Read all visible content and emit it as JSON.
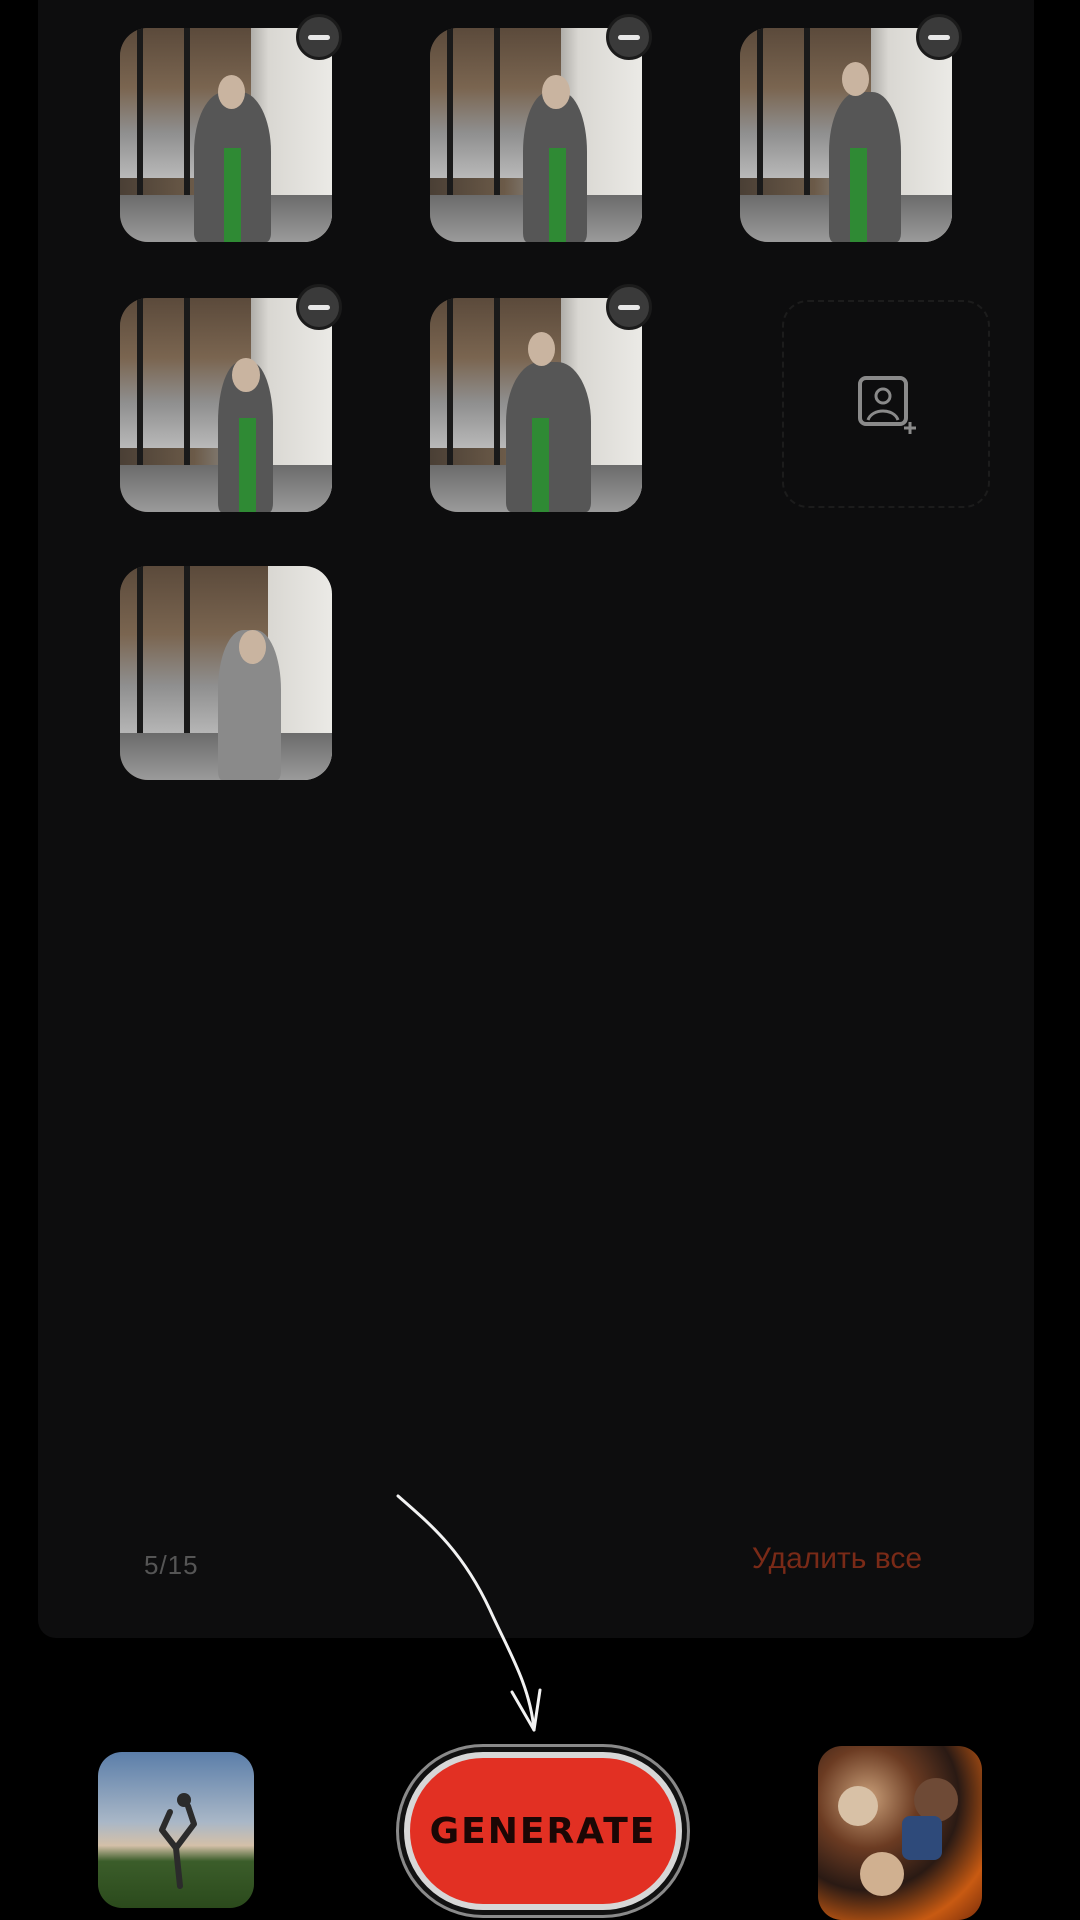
{
  "gallery": {
    "count_label": "5/15",
    "delete_all_label": "Удалить все"
  },
  "actions": {
    "generate_label": "GENERATE"
  },
  "icons": {
    "remove": "minus-circle-icon",
    "add_photo": "add-photo-icon",
    "arrow": "curved-arrow-icon"
  },
  "colors": {
    "generate": "#e23023",
    "delete_all": "#7a2a17"
  }
}
